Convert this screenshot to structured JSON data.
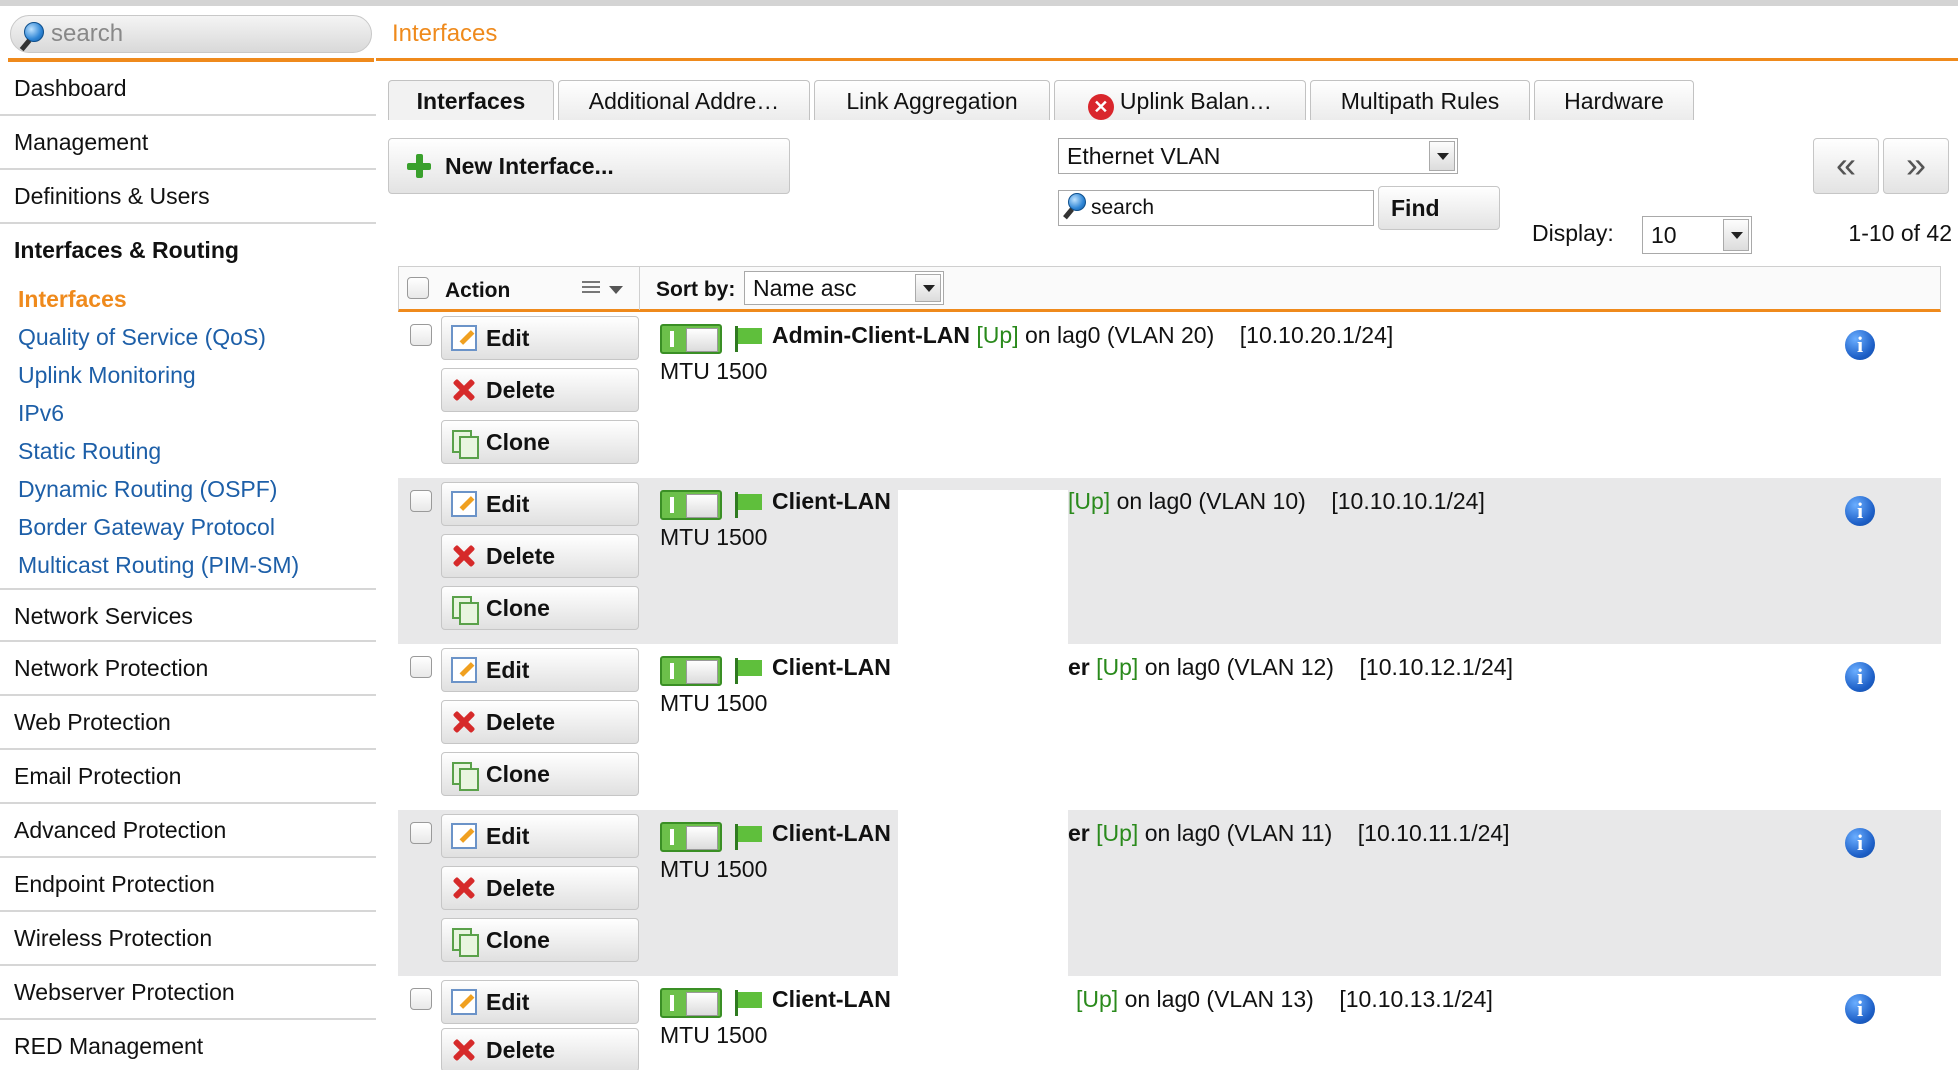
{
  "sidebar": {
    "search_placeholder": "search",
    "items_top": [
      "Dashboard",
      "Management",
      "Definitions & Users"
    ],
    "open_section": "Interfaces & Routing",
    "sub_items": [
      "Interfaces",
      "Quality of Service (QoS)",
      "Uplink Monitoring",
      "IPv6",
      "Static Routing",
      "Dynamic Routing (OSPF)",
      "Border Gateway Protocol",
      "Multicast Routing (PIM-SM)"
    ],
    "active_sub": "Interfaces",
    "items_bottom": [
      "Network Services",
      "Network Protection",
      "Web Protection",
      "Email Protection",
      "Advanced Protection",
      "Endpoint Protection",
      "Wireless Protection",
      "Webserver Protection",
      "RED Management"
    ]
  },
  "page": {
    "title": "Interfaces"
  },
  "tabs": [
    {
      "label": "Interfaces",
      "active": true
    },
    {
      "label": "Additional Addre…",
      "active": false
    },
    {
      "label": "Link Aggregation",
      "active": false
    },
    {
      "label": "Uplink Balan…",
      "active": false,
      "error_icon": "error-circle-icon"
    },
    {
      "label": "Multipath Rules",
      "active": false
    },
    {
      "label": "Hardware",
      "active": false
    }
  ],
  "toolbar": {
    "new_button": "New Interface...",
    "type_filter": "Ethernet VLAN",
    "search_placeholder": "search",
    "find_button": "Find",
    "display_label": "Display:",
    "display_value": "10",
    "first_page": "«",
    "next_page": "»",
    "range": "1-10 of 42"
  },
  "list_header": {
    "action_label": "Action",
    "sort_label": "Sort by:",
    "sort_value": "Name asc"
  },
  "row_actions": {
    "edit": "Edit",
    "delete": "Delete",
    "clone": "Clone"
  },
  "rows": [
    {
      "name": "Admin-Client-LAN",
      "name_suffix": "",
      "status": "[Up]",
      "on": "on lag0 (VLAN 20)",
      "address": "[10.10.20.1/24]",
      "mtu": "MTU 1500"
    },
    {
      "name": "Client-LAN",
      "name_suffix": "",
      "status": "[Up]",
      "on": "on lag0 (VLAN 10)",
      "address": "[10.10.10.1/24]",
      "mtu": "MTU 1500"
    },
    {
      "name": "Client-LAN",
      "name_suffix": "er",
      "status": "[Up]",
      "on": "on lag0 (VLAN 12)",
      "address": "[10.10.12.1/24]",
      "mtu": "MTU 1500"
    },
    {
      "name": "Client-LAN",
      "name_suffix": "er",
      "status": "[Up]",
      "on": "on lag0 (VLAN 11)",
      "address": "[10.10.11.1/24]",
      "mtu": "MTU 1500"
    },
    {
      "name": "Client-LAN",
      "name_suffix": "",
      "status": "[Up]",
      "on": "on lag0 (VLAN 13)",
      "address": "[10.10.13.1/24]",
      "mtu": "MTU 1500"
    }
  ],
  "colors": {
    "accent": "#ef8a1c",
    "link": "#1d5fa8",
    "status_up": "#2a8a1c",
    "alt_row": "#e8e8e9"
  }
}
